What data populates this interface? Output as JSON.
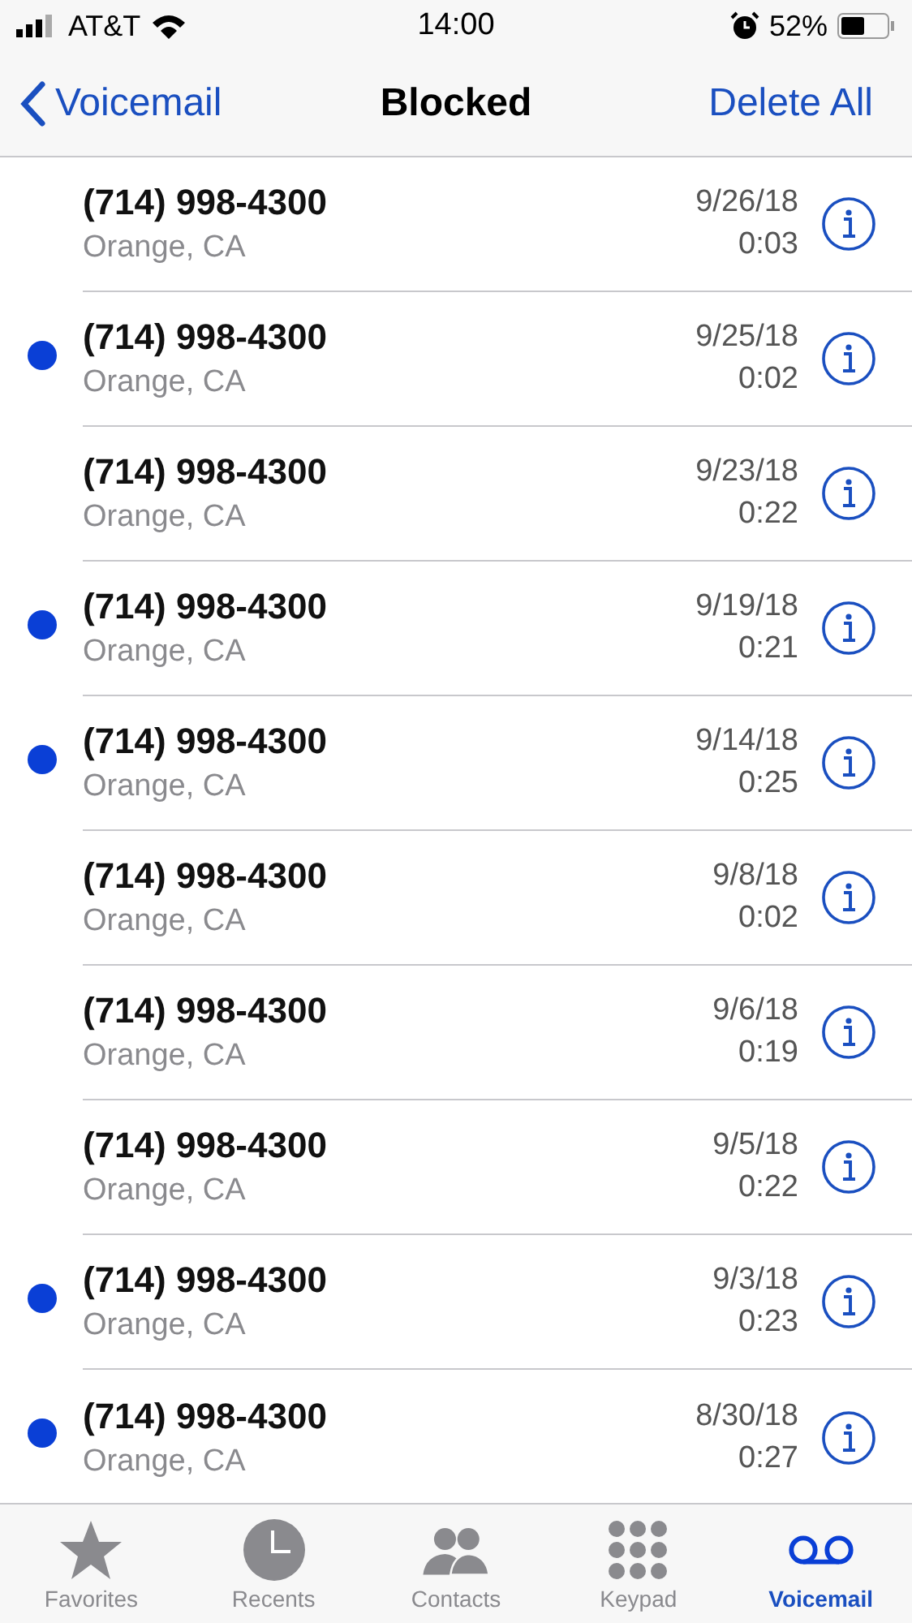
{
  "status_bar": {
    "carrier": "AT&T",
    "time": "14:00",
    "battery": "52%"
  },
  "nav": {
    "back": "Voicemail",
    "title": "Blocked",
    "action": "Delete All"
  },
  "messages": [
    {
      "number": "(714) 998-4300",
      "location": "Orange, CA",
      "date": "9/26/18",
      "duration": "0:03",
      "unread": false
    },
    {
      "number": "(714) 998-4300",
      "location": "Orange, CA",
      "date": "9/25/18",
      "duration": "0:02",
      "unread": true
    },
    {
      "number": "(714) 998-4300",
      "location": "Orange, CA",
      "date": "9/23/18",
      "duration": "0:22",
      "unread": false
    },
    {
      "number": "(714) 998-4300",
      "location": "Orange, CA",
      "date": "9/19/18",
      "duration": "0:21",
      "unread": true
    },
    {
      "number": "(714) 998-4300",
      "location": "Orange, CA",
      "date": "9/14/18",
      "duration": "0:25",
      "unread": true
    },
    {
      "number": "(714) 998-4300",
      "location": "Orange, CA",
      "date": "9/8/18",
      "duration": "0:02",
      "unread": false
    },
    {
      "number": "(714) 998-4300",
      "location": "Orange, CA",
      "date": "9/6/18",
      "duration": "0:19",
      "unread": false
    },
    {
      "number": "(714) 998-4300",
      "location": "Orange, CA",
      "date": "9/5/18",
      "duration": "0:22",
      "unread": false
    },
    {
      "number": "(714) 998-4300",
      "location": "Orange, CA",
      "date": "9/3/18",
      "duration": "0:23",
      "unread": true
    },
    {
      "number": "(714) 998-4300",
      "location": "Orange, CA",
      "date": "8/30/18",
      "duration": "0:27",
      "unread": true
    }
  ],
  "tabs": [
    {
      "label": "Favorites",
      "kind": "star",
      "selected": false
    },
    {
      "label": "Recents",
      "kind": "clock",
      "selected": false
    },
    {
      "label": "Contacts",
      "kind": "people",
      "selected": false
    },
    {
      "label": "Keypad",
      "kind": "keypad",
      "selected": false
    },
    {
      "label": "Voicemail",
      "kind": "voicemail",
      "selected": true
    }
  ]
}
